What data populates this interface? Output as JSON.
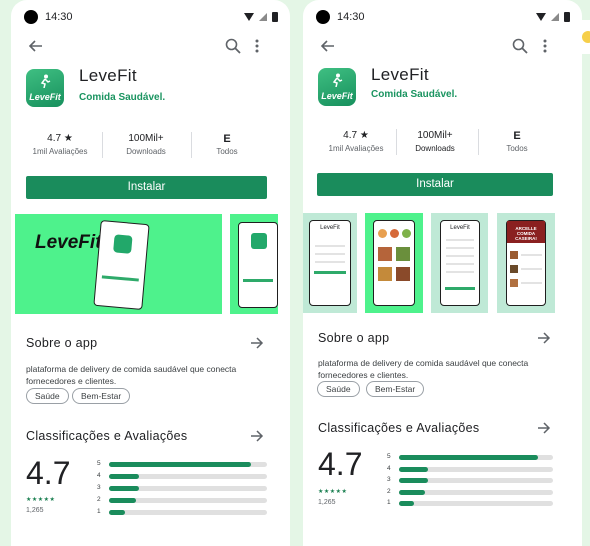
{
  "status": {
    "time": "14:30"
  },
  "app": {
    "name": "LeveFit",
    "subtitle": "Comida Saudável.",
    "icon_text": "LeveFit"
  },
  "stats": {
    "rating_value": "4.7 ★",
    "rating_label": "1mil Avaliações",
    "downloads_value": "100Mil+",
    "downloads_label": "Downloads",
    "content_rating_symbol": "E",
    "content_rating_label": "Todos"
  },
  "install_label": "Instalar",
  "promo_text": "LeveFit",
  "about": {
    "title": "Sobre o app",
    "description": "plataforma de delivery de comida saudável que conecta fornecedores e clientes.",
    "tags": [
      "Saúde",
      "Bem-Estar"
    ]
  },
  "ratings": {
    "title": "Classificações e Avaliações",
    "score": "4.7",
    "stars": "★★★★★",
    "count": "1,265",
    "bars": [
      {
        "star": "5",
        "fraction": 0.9
      },
      {
        "star": "4",
        "fraction": 0.19
      },
      {
        "star": "3",
        "fraction": 0.19
      },
      {
        "star": "2",
        "fraction": 0.17
      },
      {
        "star": "1",
        "fraction": 0.1
      }
    ]
  },
  "shot_texts": {
    "hero_title": "LeveFit",
    "banner": "ARCELLE\nCOMIDA CASEIRA!"
  },
  "colors": {
    "accent": "#1a8c5c",
    "promo_green": "#4ef28c",
    "mint": "#bfe9d6",
    "background": "#e4f6e6"
  },
  "icons": [
    "back-arrow-icon",
    "search-icon",
    "more-vert-icon",
    "arrow-right-icon",
    "wifi-icon",
    "signal-icon",
    "battery-icon",
    "camera-icon"
  ]
}
